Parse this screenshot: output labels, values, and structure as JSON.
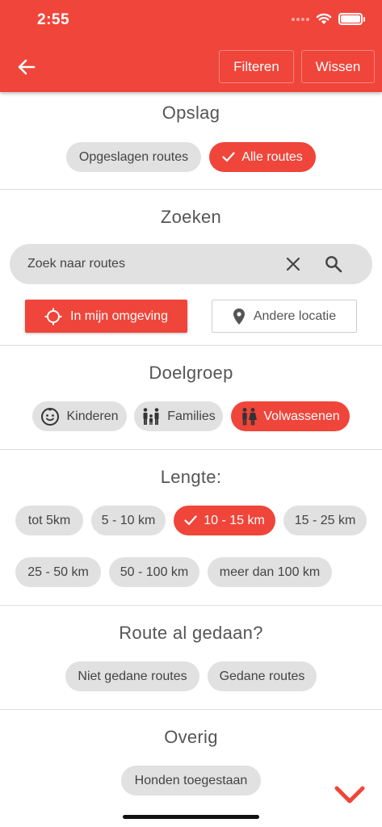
{
  "status_bar": {
    "time": "2:55"
  },
  "header": {
    "filter_label": "Filteren",
    "clear_label": "Wissen"
  },
  "storage": {
    "title": "Opslag",
    "options": [
      {
        "label": "Opgeslagen routes",
        "selected": false
      },
      {
        "label": "Alle routes",
        "selected": true
      }
    ]
  },
  "search": {
    "title": "Zoeken",
    "placeholder": "Zoek naar routes",
    "near_me_label": "In mijn omgeving",
    "other_location_label": "Andere locatie"
  },
  "audience": {
    "title": "Doelgroep",
    "options": [
      {
        "label": "Kinderen",
        "icon": "child-face-icon",
        "selected": false
      },
      {
        "label": "Families",
        "icon": "family-icon",
        "selected": false
      },
      {
        "label": "Volwassenen",
        "icon": "adults-icon",
        "selected": true
      }
    ]
  },
  "length": {
    "title": "Lengte:",
    "options": [
      {
        "label": "tot 5km",
        "selected": false
      },
      {
        "label": "5 - 10 km",
        "selected": false
      },
      {
        "label": "10 - 15 km",
        "selected": true
      },
      {
        "label": "15 - 25 km",
        "selected": false
      },
      {
        "label": "25 - 50 km",
        "selected": false
      },
      {
        "label": "50 - 100 km",
        "selected": false
      },
      {
        "label": "meer dan 100 km",
        "selected": false
      }
    ]
  },
  "done": {
    "title": "Route al gedaan?",
    "options": [
      {
        "label": "Niet gedane routes",
        "selected": false
      },
      {
        "label": "Gedane routes",
        "selected": false
      }
    ]
  },
  "other": {
    "title": "Overig",
    "options": [
      {
        "label": "Honden toegestaan",
        "selected": false
      }
    ]
  },
  "colors": {
    "accent": "#f0453a",
    "chip": "#e1e1e1",
    "text": "#444444"
  }
}
